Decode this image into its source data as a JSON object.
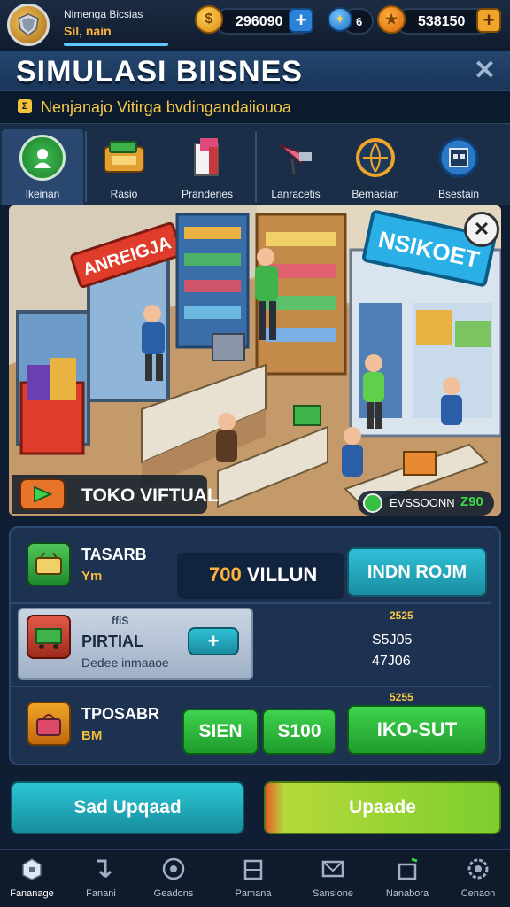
{
  "player": {
    "name": "Nimenga Bicsias",
    "sub": "Sil, nain"
  },
  "resources": [
    {
      "icon": "gold-coin-icon",
      "value": "296090"
    },
    {
      "icon": "gem-coin-icon",
      "value": "6"
    },
    {
      "icon": "orange-coin-icon",
      "value": "538150"
    }
  ],
  "title": "SIMULASI BIISNES",
  "subtitle": "Nenjanajo Vitirga bvdingandaiiouoa",
  "subtitle_icon": "Σ",
  "categories": [
    {
      "label": "Ikeinan",
      "icon": "profile-badge-icon",
      "active": true
    },
    {
      "label": "Rasio",
      "icon": "cash-register-icon"
    },
    {
      "label": "Prandenes",
      "icon": "product-box-icon"
    },
    {
      "label": "Lanracetis",
      "icon": "megaphone-icon"
    },
    {
      "label": "Bemacian",
      "icon": "globe-icon"
    },
    {
      "label": "Bsestain",
      "icon": "store-icon"
    }
  ],
  "scene": {
    "sign_left": "ANREIGJA",
    "sign_right": "NSIKOET",
    "store_label": "TOKO VIFTUAL",
    "profit_label": "EVSSOONN",
    "profit_value": "Z90"
  },
  "stats": {
    "row1": {
      "title": "TASARB",
      "sub": "Ym",
      "value_highlight": "700",
      "value_rest": " VILLUN",
      "button": "INDN ROJM"
    },
    "row2": {
      "tag": "ffiS",
      "title": "PIRTIAL",
      "desc": "Dedee inmaaoe",
      "add": "+",
      "head": "2525",
      "v1": "S5J05",
      "v2": "47J06"
    },
    "row3": {
      "title": "TPOSABR",
      "sub": "BM",
      "head": "5255",
      "b1": "SIEN",
      "b2": "S100",
      "b3": "IKO-SUT"
    }
  },
  "buttons": {
    "left": "Sad Upqaad",
    "right": "Upaade"
  },
  "nav": [
    {
      "label": "Fananage",
      "icon": "shop-icon",
      "active": true
    },
    {
      "label": "Fanani",
      "icon": "arrow-icon"
    },
    {
      "label": "Geadons",
      "icon": "target-icon"
    },
    {
      "label": "Pamana",
      "icon": "building-icon"
    },
    {
      "label": "Sansione",
      "icon": "mail-icon"
    },
    {
      "label": "Nanabora",
      "icon": "gift-icon"
    },
    {
      "label": "Cenaon",
      "icon": "settings-icon"
    }
  ],
  "colors": {
    "accent_gold": "#f6c845",
    "accent_cyan": "#2fc1d7",
    "accent_green": "#3fd34d",
    "bg": "#0f1e33"
  }
}
